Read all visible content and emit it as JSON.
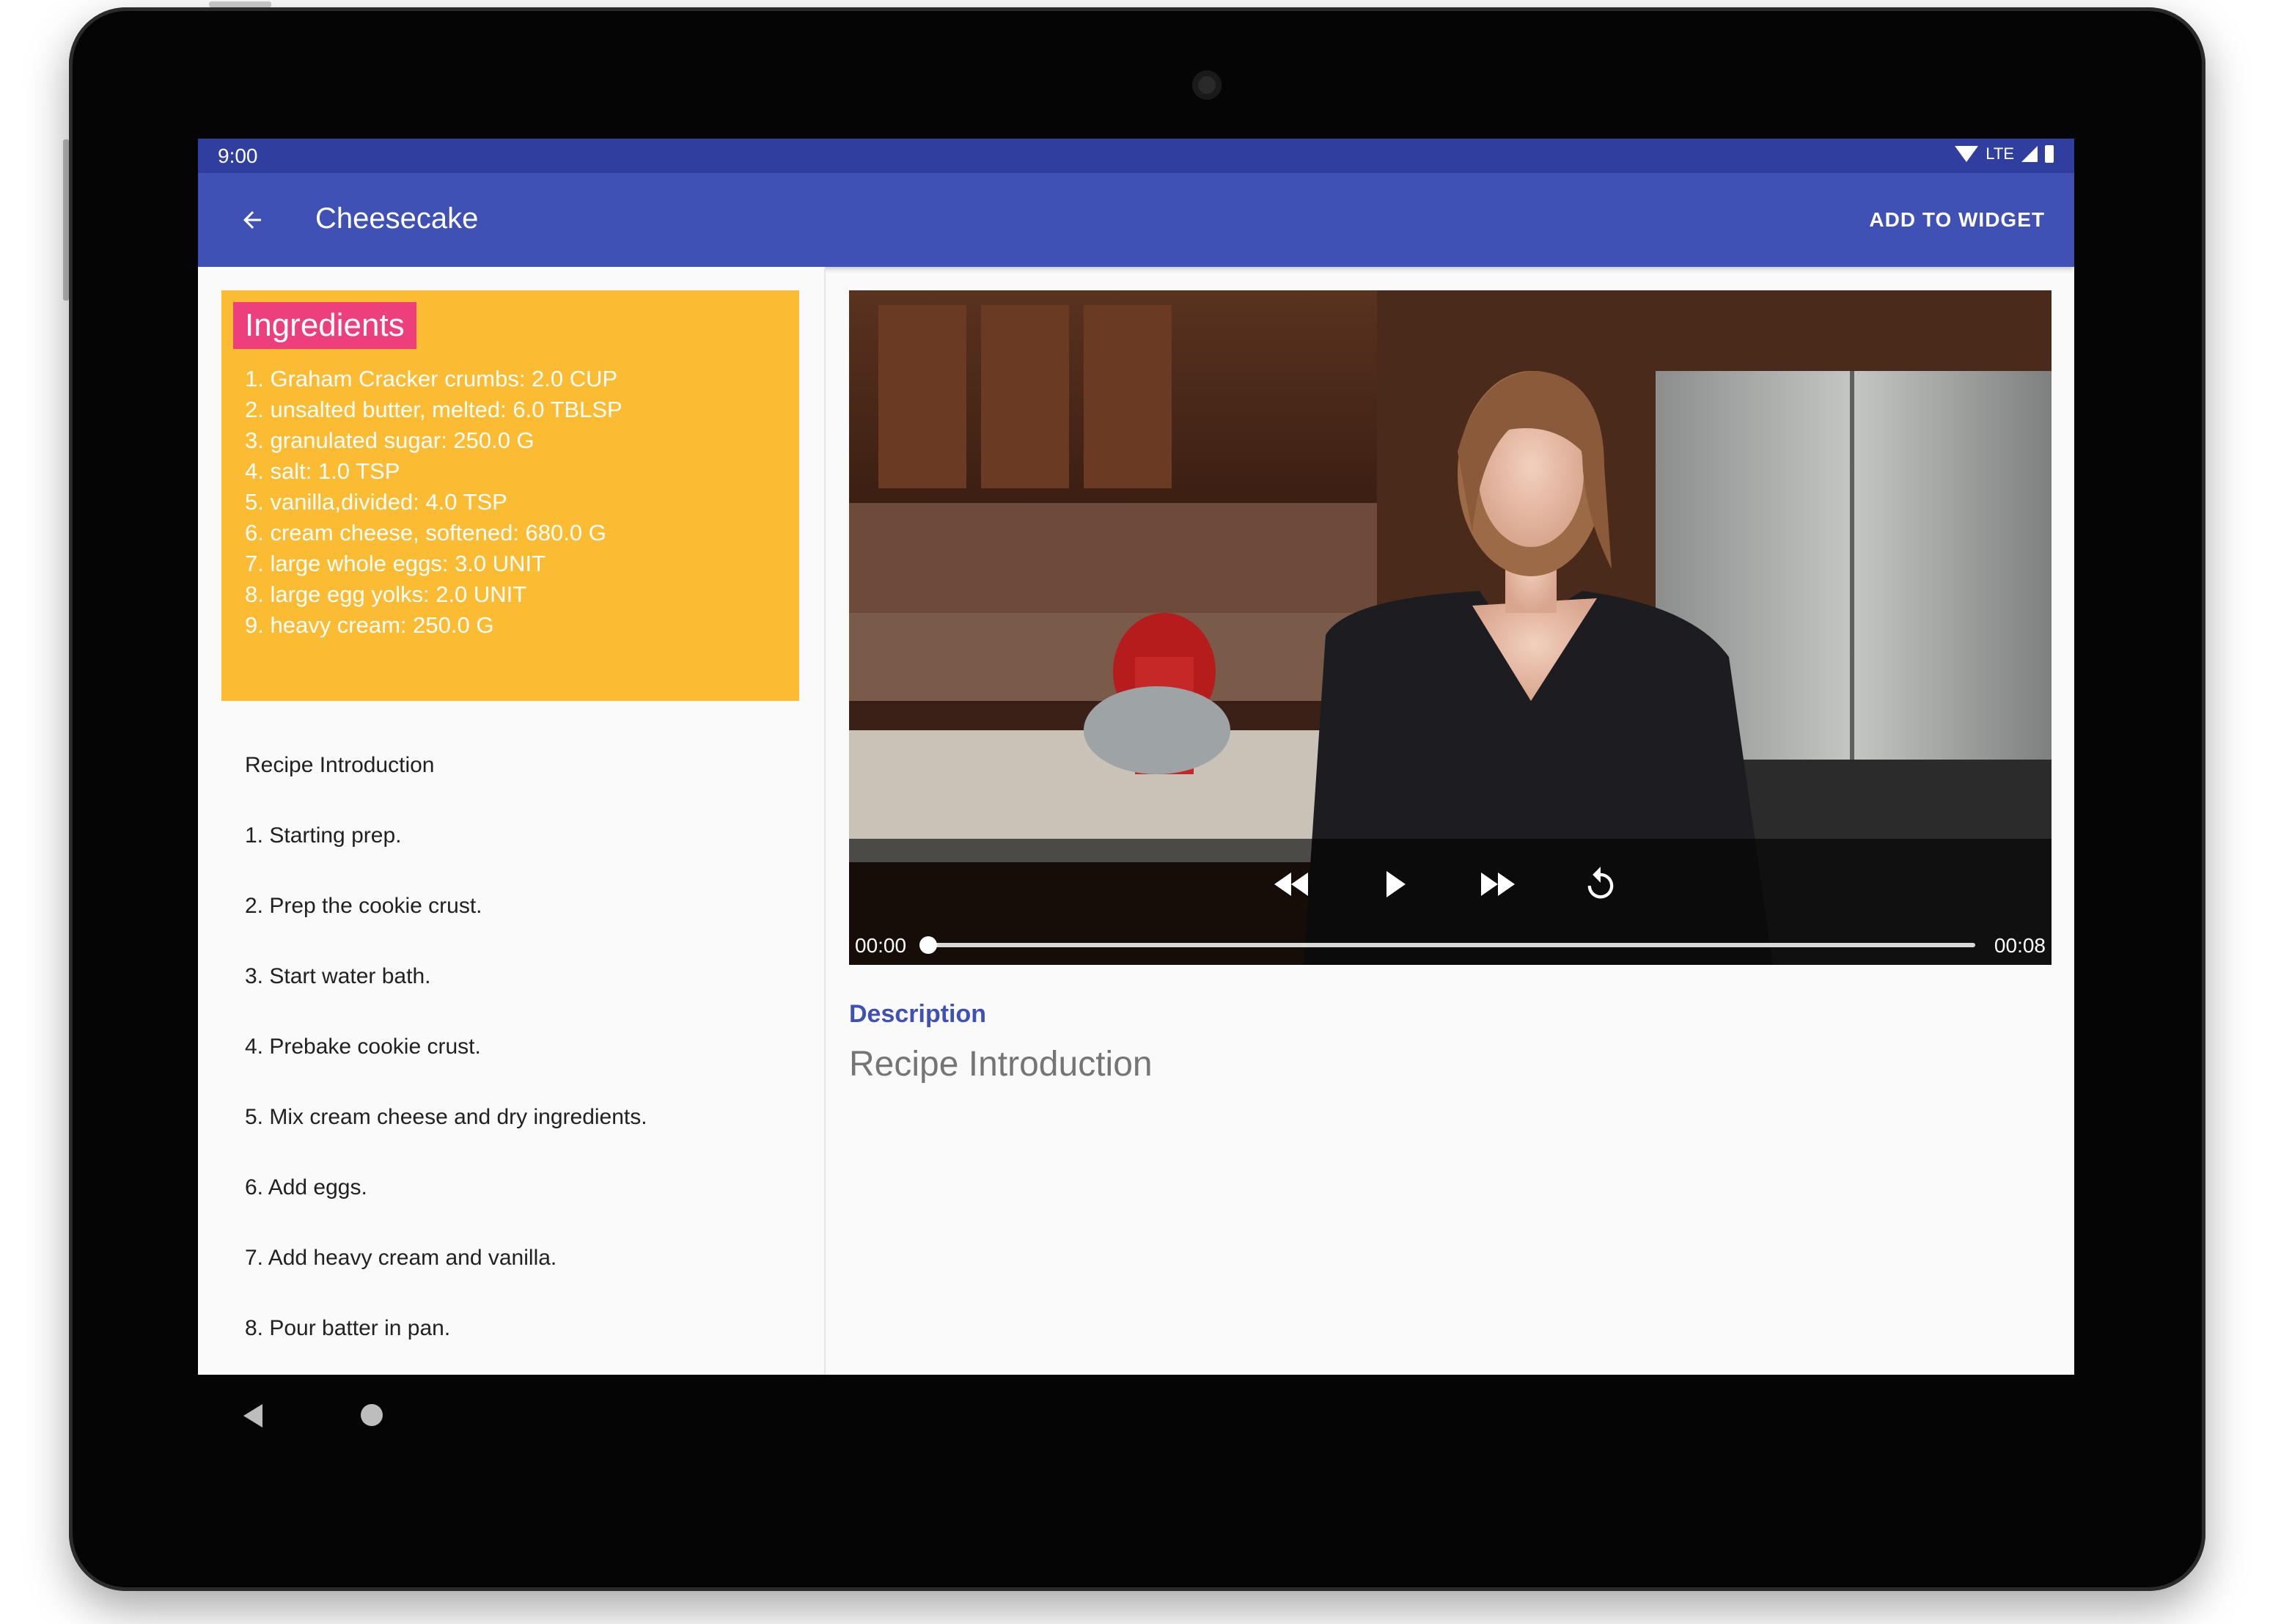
{
  "status_bar": {
    "time": "9:00",
    "network": "LTE"
  },
  "app_bar": {
    "title": "Cheesecake",
    "action": "ADD TO WIDGET",
    "back_icon": "arrow-left-icon"
  },
  "ingredients": {
    "title": "Ingredients",
    "items": [
      "1. Graham Cracker crumbs: 2.0 CUP",
      "2. unsalted butter, melted: 6.0 TBLSP",
      "3. granulated sugar: 250.0 G",
      "4. salt: 1.0 TSP",
      "5. vanilla,divided: 4.0 TSP",
      "6. cream cheese, softened: 680.0 G",
      "7. large whole eggs: 3.0 UNIT",
      "8. large egg yolks: 2.0 UNIT",
      "9. heavy cream: 250.0 G"
    ]
  },
  "steps": [
    "Recipe Introduction",
    "1. Starting prep.",
    "2. Prep the cookie crust.",
    "3. Start water bath.",
    "4. Prebake cookie crust.",
    "5. Mix cream cheese and dry ingredients.",
    "6. Add eggs.",
    "7. Add heavy cream and vanilla.",
    "8. Pour batter in pan."
  ],
  "player": {
    "time_current": "00:00",
    "time_total": "00:08",
    "progress": 0.0,
    "icons": [
      "rewind-icon",
      "play-icon",
      "fast-forward-icon",
      "replay-icon"
    ]
  },
  "description": {
    "label": "Description",
    "text": "Recipe Introduction"
  },
  "colors": {
    "primary": "#3f51b5",
    "primary_dark": "#303f9f",
    "ingredients_bg": "#fbbc33",
    "ingredients_title_bg": "#ee3f7d"
  }
}
